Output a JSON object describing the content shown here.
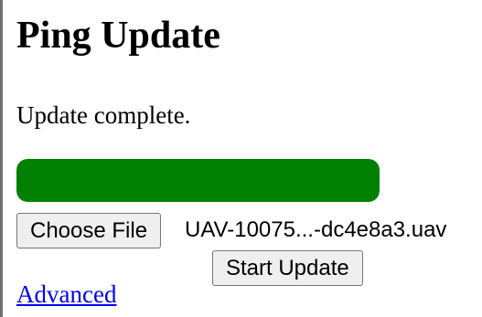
{
  "page": {
    "title": "Ping Update"
  },
  "status": {
    "message": "Update complete."
  },
  "progress": {
    "percent": 100,
    "color": "#008000"
  },
  "file_input": {
    "button_label": "Choose File",
    "selected_file": "UAV-10075...-dc4e8a3.uav"
  },
  "actions": {
    "start_update_label": "Start Update"
  },
  "links": {
    "advanced_label": "Advanced",
    "link_color": "#0000ee"
  }
}
